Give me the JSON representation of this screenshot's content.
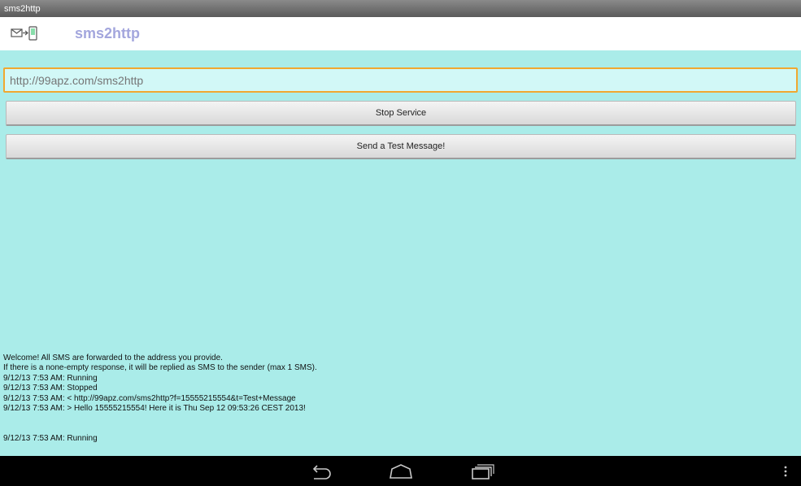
{
  "window": {
    "title": "sms2http"
  },
  "header": {
    "app_icon": "sms-forward-icon",
    "app_title": "sms2http"
  },
  "form": {
    "url_placeholder": "http://99apz.com/sms2http",
    "stop_service_label": "Stop Service",
    "send_test_label": "Send a Test Message!"
  },
  "log": {
    "welcome_line1": "Welcome! All SMS are forwarded to the address you provide.",
    "welcome_line2": "If there is a none-empty response, it will be replied as SMS to the sender (max 1 SMS).",
    "entries": [
      "9/12/13 7:53 AM: Running",
      "9/12/13 7:53 AM: Stopped",
      "9/12/13 7:53 AM: < http://99apz.com/sms2http?f=15555215554&t=Test+Message",
      "9/12/13 7:53 AM: > Hello 15555215554! Here it is Thu Sep 12 09:53:26 CEST 2013!",
      "9/12/13 7:53 AM: Running"
    ]
  },
  "navbar": {
    "icons": [
      "back-icon",
      "home-icon",
      "recent-apps-icon",
      "overflow-menu-icon"
    ]
  },
  "colors": {
    "background": "#aaece9",
    "title_accent": "#a3a6dd",
    "input_focus_border": "#f0a830"
  }
}
